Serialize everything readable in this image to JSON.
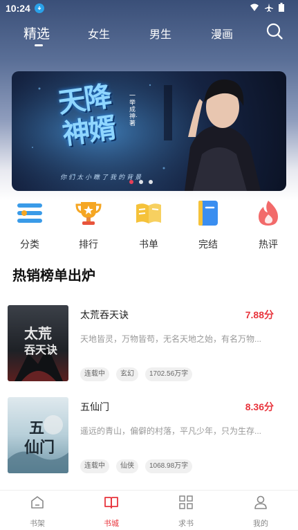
{
  "status_bar": {
    "time": "10:24"
  },
  "top_tabs": [
    {
      "label": "精选",
      "active": true
    },
    {
      "label": "女生",
      "active": false
    },
    {
      "label": "男生",
      "active": false
    },
    {
      "label": "漫画",
      "active": false
    }
  ],
  "banner": {
    "title": "天降神婿",
    "author": "一举成神·著",
    "tagline": "你们太小瞧了我的背景"
  },
  "quick_entries": [
    {
      "label": "分类",
      "icon": "category-icon",
      "color": "#3a9be8"
    },
    {
      "label": "排行",
      "icon": "trophy-icon",
      "color": "#f5a623"
    },
    {
      "label": "书单",
      "icon": "open-book-icon",
      "color": "#f5c23a"
    },
    {
      "label": "完结",
      "icon": "bookmark-book-icon",
      "color": "#3a8ef0"
    },
    {
      "label": "热评",
      "icon": "flame-icon",
      "color": "#f26a6a"
    }
  ],
  "section": {
    "title": "热销榜单出炉"
  },
  "books": [
    {
      "title": "太荒吞天诀",
      "score": "7.88分",
      "description": "天地皆灵，万物皆苟，无名天地之始，有名万物...",
      "tags": [
        "连载中",
        "玄幻",
        "1702.56万字"
      ]
    },
    {
      "title": "五仙门",
      "score": "8.36分",
      "description": "遥远的青山，偏僻的村落，平凡少年，只为生存...",
      "tags": [
        "连载中",
        "仙侠",
        "1068.98万字"
      ]
    }
  ],
  "bottom_nav": [
    {
      "label": "书架",
      "icon": "bookshelf-icon",
      "active": false
    },
    {
      "label": "书城",
      "icon": "bookstore-icon",
      "active": true
    },
    {
      "label": "求书",
      "icon": "grid-icon",
      "active": false
    },
    {
      "label": "我的",
      "icon": "user-icon",
      "active": false
    }
  ],
  "colors": {
    "accent": "#e8343c"
  }
}
